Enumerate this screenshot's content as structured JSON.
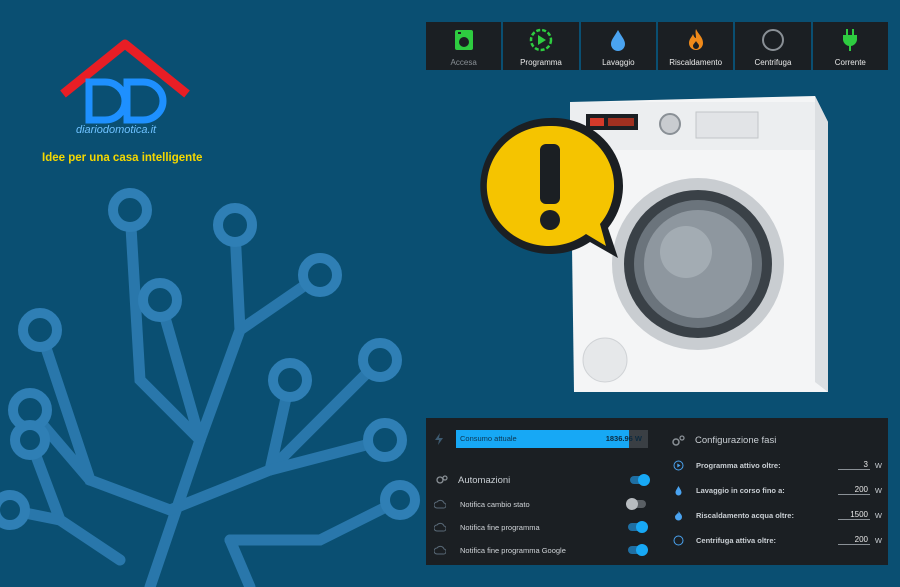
{
  "brand": {
    "name": "diariodomotica.it",
    "tagline": "Idee per una casa intelligente"
  },
  "status_bar": [
    {
      "label": "Accesa",
      "icon": "washing-machine-icon",
      "color": "#2ecc40",
      "dim": true
    },
    {
      "label": "Programma",
      "icon": "play-circle-icon",
      "color": "#2ecc40",
      "dim": false
    },
    {
      "label": "Lavaggio",
      "icon": "water-drop-icon",
      "color": "#4aa3f0",
      "dim": false
    },
    {
      "label": "Riscaldamento",
      "icon": "fire-icon",
      "color": "#f08a1a",
      "dim": false
    },
    {
      "label": "Centrifuga",
      "icon": "circle-icon",
      "color": "#8a9096",
      "dim": false
    },
    {
      "label": "Corrente",
      "icon": "plug-icon",
      "color": "#2ecc40",
      "dim": false
    }
  ],
  "power": {
    "label": "Consumo attuale",
    "value": "1836.96 W",
    "fill_fraction": 0.9
  },
  "automations": {
    "title": "Automazioni",
    "items": [
      {
        "label": "Notifica cambio stato",
        "on": false
      },
      {
        "label": "Notifica fine programma",
        "on": true
      },
      {
        "label": "Notifica fine programma Google",
        "on": true
      }
    ],
    "master_on": true
  },
  "config": {
    "title": "Configurazione fasi",
    "items": [
      {
        "label": "Programma attivo oltre:",
        "value": "3",
        "unit": "W",
        "icon": "play-circle-icon"
      },
      {
        "label": "Lavaggio in corso fino a:",
        "value": "200",
        "unit": "W",
        "icon": "water-drop-icon"
      },
      {
        "label": "Riscaldamento acqua oltre:",
        "value": "1500",
        "unit": "W",
        "icon": "fire-icon"
      },
      {
        "label": "Centrifuga attiva oltre:",
        "value": "200",
        "unit": "W",
        "icon": "circle-icon"
      }
    ]
  },
  "colors": {
    "background": "#0a4f72",
    "panel": "#1b1f23",
    "accent": "#17a8f5",
    "tagline": "#f5d800",
    "warning": "#f5c400"
  }
}
